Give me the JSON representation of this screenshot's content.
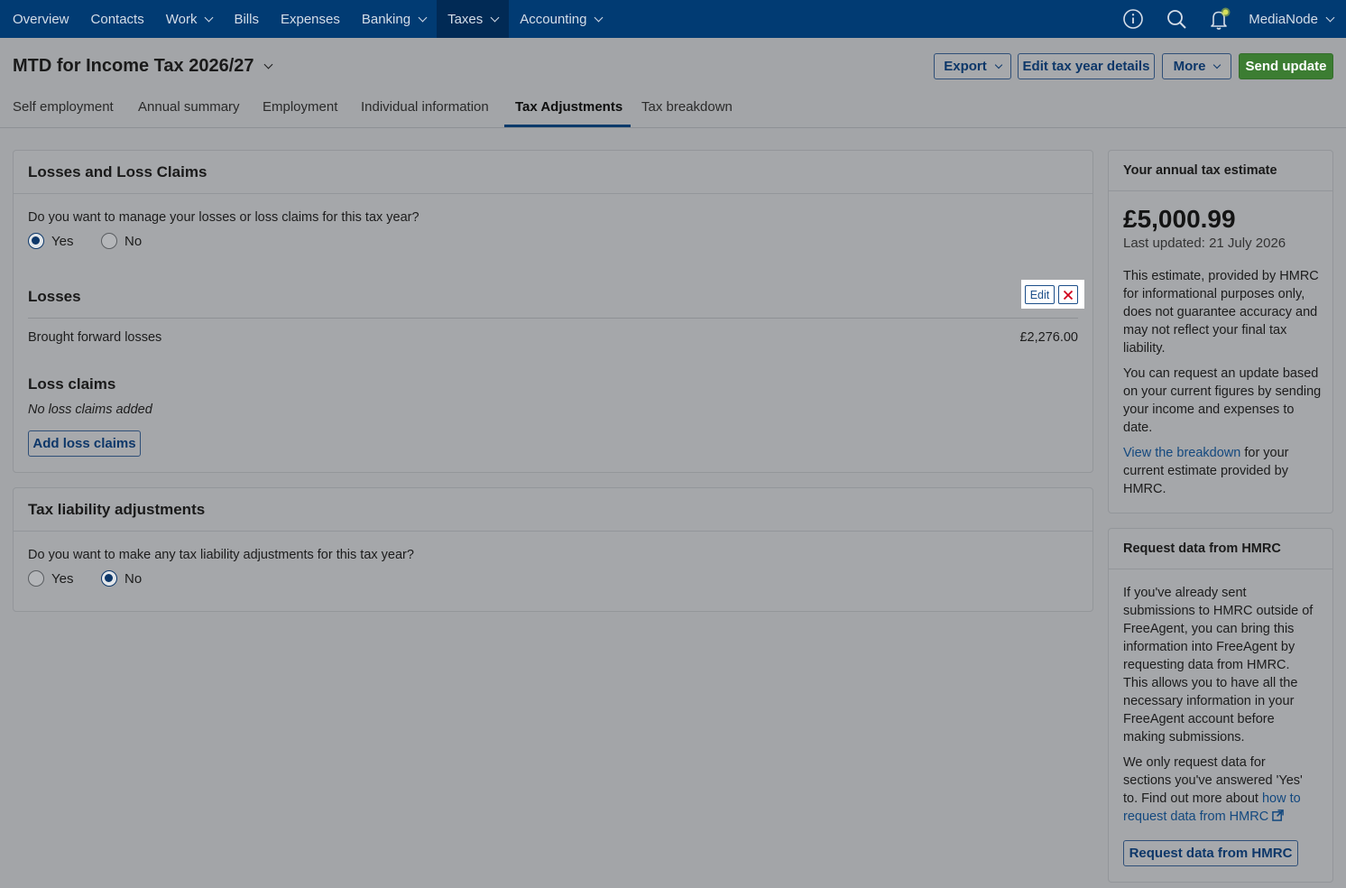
{
  "nav": {
    "items": [
      {
        "label": "Overview"
      },
      {
        "label": "Contacts"
      },
      {
        "label": "Work",
        "dropdown": true
      },
      {
        "label": "Bills"
      },
      {
        "label": "Expenses"
      },
      {
        "label": "Banking",
        "dropdown": true
      },
      {
        "label": "Taxes",
        "dropdown": true,
        "active": true
      },
      {
        "label": "Accounting",
        "dropdown": true
      }
    ],
    "account_name": "MediaNode",
    "icons": [
      "info-icon",
      "search-icon",
      "bell-icon"
    ]
  },
  "header": {
    "title": "MTD for Income Tax 2026/27",
    "export_label": "Export",
    "edit_tax_year_label": "Edit tax year details",
    "more_label": "More",
    "send_update_label": "Send update",
    "tabs": [
      {
        "label": "Self employment"
      },
      {
        "label": "Annual summary"
      },
      {
        "label": "Employment"
      },
      {
        "label": "Individual information"
      },
      {
        "label": "Tax Adjustments",
        "active": true
      },
      {
        "label": "Tax breakdown"
      }
    ]
  },
  "losses_card": {
    "title": "Losses and Loss Claims",
    "question": "Do you want to manage your losses or loss claims for this tax year?",
    "yes_label": "Yes",
    "no_label": "No",
    "selected": "Yes",
    "losses_heading": "Losses",
    "edit_label": "Edit",
    "brought_forward_label": "Brought forward losses",
    "brought_forward_value": "£2,276.00",
    "loss_claims_heading": "Loss claims",
    "no_claims_text": "No loss claims added",
    "add_claims_label": "Add loss claims"
  },
  "liability_card": {
    "title": "Tax liability adjustments",
    "question": "Do you want to make any tax liability adjustments for this tax year?",
    "yes_label": "Yes",
    "no_label": "No",
    "selected": "No"
  },
  "estimate_card": {
    "title": "Your annual tax estimate",
    "amount": "£5,000.99",
    "last_updated": "Last updated: 21 July 2026",
    "para1": "This estimate, provided by HMRC for informational purposes only, does not guarantee accuracy and may not reflect your final tax liability.",
    "para2": "You can request an update based on your current figures by sending your income and expenses to date.",
    "link_text": "View the breakdown",
    "para3_rest": " for your current estimate provided by HMRC."
  },
  "request_card": {
    "title": "Request data from HMRC",
    "para1": "If you've already sent submissions to HMRC outside of FreeAgent, you can bring this information into FreeAgent by requesting data from HMRC. This allows you to have all the necessary information in your FreeAgent account before making submissions.",
    "para2_start": "We only request data for sections you've answered 'Yes' to. Find out more about ",
    "link_text": "how to request data from HMRC",
    "button_label": "Request data from HMRC"
  },
  "colors": {
    "nav_bg": "#013b73",
    "primary": "#0d3769",
    "send_update": "#3c7d32",
    "delete": "#d0021b"
  }
}
